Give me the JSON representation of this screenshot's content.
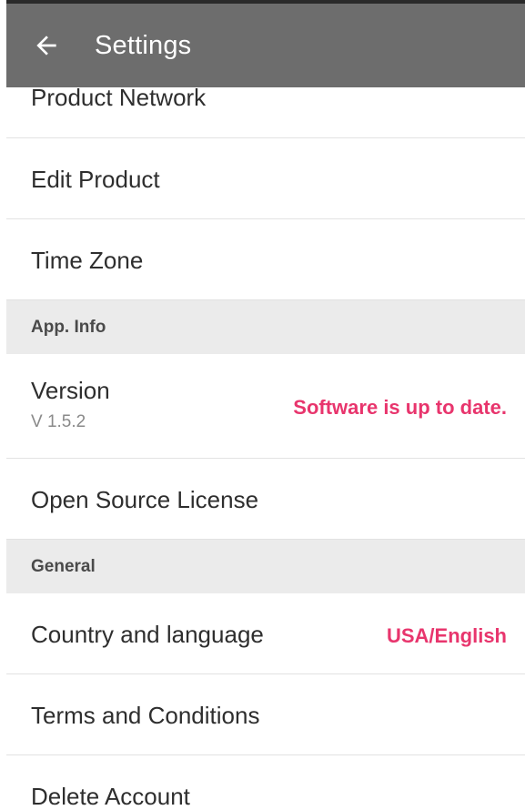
{
  "app_bar": {
    "title": "Settings",
    "back_icon": "arrow-back-icon"
  },
  "items": {
    "product_network": "Product Network",
    "edit_product": "Edit Product",
    "time_zone": "Time Zone",
    "app_info_header": "App. Info",
    "version": {
      "label": "Version",
      "value": "V 1.5.2",
      "status": "Software is up to date."
    },
    "open_source_license": "Open Source License",
    "general_header": "General",
    "country_language": {
      "label": "Country and language",
      "value": "USA/English"
    },
    "terms": "Terms and Conditions",
    "delete_account": "Delete Account"
  },
  "colors": {
    "app_bar": "#6d6d6d",
    "accent": "#e8356d",
    "section_bg": "#ebebeb"
  }
}
